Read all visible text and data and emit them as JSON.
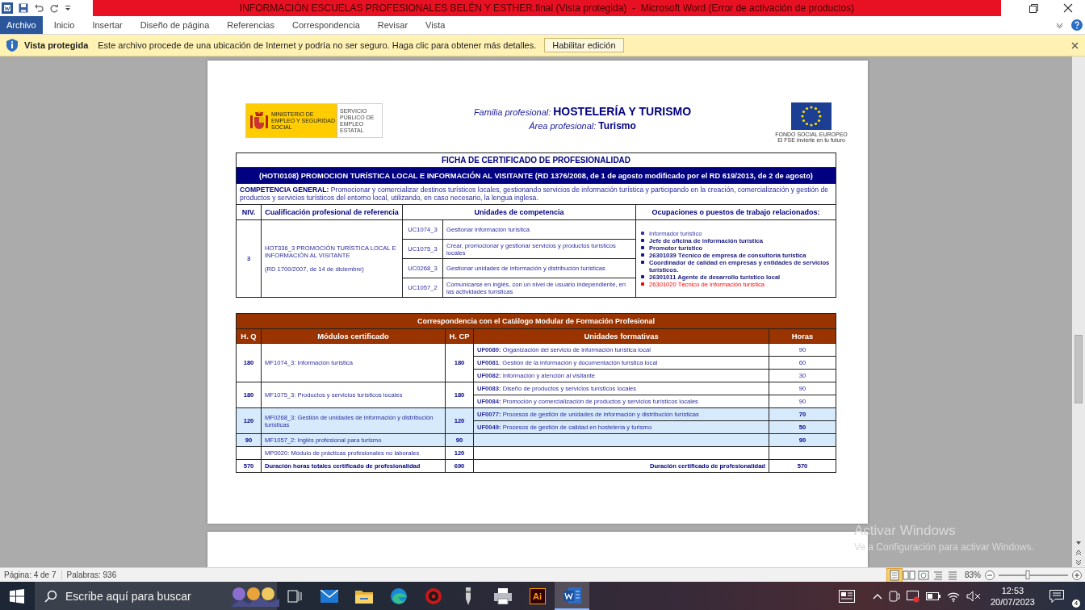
{
  "title_bar": {
    "title": "INFORMACIÓN ESCUELAS PROFESIONALES BELÉN Y ESTHER.final (Vista protegida)  -  Microsoft Word (Error de activación de productos)"
  },
  "ribbon_tabs": [
    {
      "label": "Archivo",
      "selected": true
    },
    {
      "label": "Inicio",
      "selected": false
    },
    {
      "label": "Insertar",
      "selected": false
    },
    {
      "label": "Diseño de página",
      "selected": false
    },
    {
      "label": "Referencias",
      "selected": false
    },
    {
      "label": "Correspondencia",
      "selected": false
    },
    {
      "label": "Revisar",
      "selected": false
    },
    {
      "label": "Vista",
      "selected": false
    }
  ],
  "message_bar": {
    "label": "Vista protegida",
    "message": "Este archivo procede de una ubicación de Internet y podría no ser seguro. Haga clic para obtener más detalles.",
    "button": "Habilitar edición"
  },
  "document": {
    "logos": {
      "ministry": "MINISTERIO DE EMPLEO Y SEGURIDAD SOCIAL",
      "service": "SERVICIO PÚBLICO DE EMPLEO ESTATAL",
      "fund": "FONDO SOCIAL EUROPEO",
      "fund_motto": "El FSE invierte en tu futuro"
    },
    "header": {
      "family_label": "Familia profesional:",
      "family": "HOSTELERÍA Y TURISMO",
      "area_label": "Área profesional:",
      "area": "Turismo"
    },
    "certificate": {
      "heading": "FICHA DE CERTIFICADO DE PROFESIONALIDAD",
      "title": "(HOTI0108) PROMOCION TURÍSTICA LOCAL E INFORMACIÓN AL VISITANTE (RD 1376/2008, de 1 de agosto modificado por el RD 619/2013, de 2 de agosto)",
      "competence": "**COMPETENCIA GENERAL:** Promocionar y comercializar destinos turísticos locales, gestionando servicios de información turística y participando en la creación, comercialización y gestión de productos y servicios turísticos del entorno local, utilizando, en caso necesario, la lengua inglesa.",
      "columns": [
        "NIV.",
        "Cualificación profesional de referencia",
        "Unidades de competencia",
        "Ocupaciones o puestos de trabajo relacionados:"
      ],
      "level": "3",
      "qualification": "HOT336_3 PROMOCIÓN TURÍSTICA LOCAL E INFORMACIÓN AL VISITANTE",
      "qualification_ref": "(RD 1700/2007, de 14 de diciembre)",
      "units": [
        {
          "code": "UC1074_3",
          "name": "Gestionar información turística"
        },
        {
          "code": "UC1075_3",
          "name": "Crear, promocionar y gestionar servicios y productos turísticos locales"
        },
        {
          "code": "UC0268_3",
          "name": "Gestionar unidades de información y distribución turísticas"
        },
        {
          "code": "UC1057_2",
          "name": "Comunicarse en inglés, con un nivel de usuario independiente, en las actividades turísticas"
        }
      ],
      "occupations": [
        {
          "text": "Informador turístico",
          "bold": false,
          "color": "#3333aa"
        },
        {
          "text": "Jefe de oficina de información turística",
          "bold": true,
          "color": "#1a1a80"
        },
        {
          "text": "Promotor turístico",
          "bold": true,
          "color": "#1a1a80"
        },
        {
          "text": "26301039 Técnico de empresa de consultoría turística",
          "bold": true,
          "color": "#1a1a80"
        },
        {
          "text": "Coordinador de calidad en empresas y entidades de servicios turísticos.",
          "bold": true,
          "color": "#1a1a80"
        },
        {
          "text": "26301011 Agente de desarrollo turístico local",
          "bold": true,
          "color": "#1a1a80"
        },
        {
          "text": "26301020 Técnico de información turística",
          "bold": false,
          "color": "#ff0000"
        }
      ]
    },
    "correspondence": {
      "title": "Correspondencia con el Catálogo Modular de Formación Profesional",
      "columns": [
        "H. Q",
        "Módulos certificado",
        "H. CP",
        "Unidades formativas",
        "Horas"
      ],
      "modules": [
        {
          "hq": "180",
          "module": "MF1074_3: Información turística",
          "hcp": "180",
          "highlighted": false,
          "units": [
            {
              "text": "**UF0080:** Organización del servicio de información turística local",
              "hours": "90"
            },
            {
              "text": "**UF0081**: Gestión de la información y documentación turística local",
              "hours": "60"
            },
            {
              "text": "**UF0082:** Información y atención al visitante",
              "hours": "30"
            }
          ]
        },
        {
          "hq": "180",
          "module": "MF1075_3: Productos y servicios turísticos locales",
          "hcp": "180",
          "highlighted": false,
          "units": [
            {
              "text": "**UF0083:** Diseño de productos y servicios turísticos locales",
              "hours": "90"
            },
            {
              "text": "**UF0084:** Promoción y comercialización de productos y servicios turísticos locales",
              "hours": "90"
            }
          ]
        },
        {
          "hq": "120",
          "module": "MF0268_3: Gestión de unidades de información y distribución turísticas",
          "hcp": "120",
          "highlighted": true,
          "units": [
            {
              "text": "**UF0077:** Procesos de gestión de unidades de información y distribución turísticas",
              "hours": "70"
            },
            {
              "text": "**UF0049:** Procesos de gestión de calidad en hostelería y turismo",
              "hours": "50"
            }
          ]
        },
        {
          "hq": "90",
          "module": "MF1057_2: Inglés profesional para turismo",
          "hcp": "90",
          "highlighted": true,
          "units": [
            {
              "hours": "90"
            }
          ]
        },
        {
          "module": "MP0020: Módulo de prácticas profesionales no laborales",
          "hcp": "120",
          "highlighted": false
        }
      ],
      "total": {
        "hq": "570",
        "label": "Duración horas totales certificado de profesionalidad",
        "hcp": "690",
        "units_label": "Duración certificado de profesionalidad",
        "hours": "570"
      }
    }
  },
  "activation_notice": {
    "title": "Activar Windows",
    "message": "Ve a Configuración para activar Windows."
  },
  "status_bar": {
    "page": "Página: 4 de 7",
    "words": "Palabras: 936",
    "views": [
      {
        "kind": "print",
        "selected": true
      },
      {
        "kind": "reading",
        "selected": false
      },
      {
        "kind": "web",
        "selected": false
      },
      {
        "kind": "outline",
        "selected": false
      },
      {
        "kind": "draft",
        "selected": false
      }
    ],
    "zoom": "83%",
    "zoom_slider": {
      "level": 0.42
    }
  },
  "taskbar": {
    "search_placeholder": "Escribe aquí para buscar",
    "apps": [
      {
        "kind": "taskview",
        "selected": false
      },
      {
        "kind": "mail",
        "selected": false
      },
      {
        "kind": "explorer",
        "selected": false
      },
      {
        "kind": "browser",
        "selected": false
      },
      {
        "kind": "media",
        "selected": false
      },
      {
        "kind": "pen",
        "selected": false
      },
      {
        "kind": "printer",
        "selected": false
      },
      {
        "kind": "illustrator",
        "label": "Ai",
        "selected": false
      },
      {
        "kind": "word",
        "selected": true
      }
    ],
    "time": "12:53",
    "date": "20/07/2023",
    "notifications": "4"
  }
}
